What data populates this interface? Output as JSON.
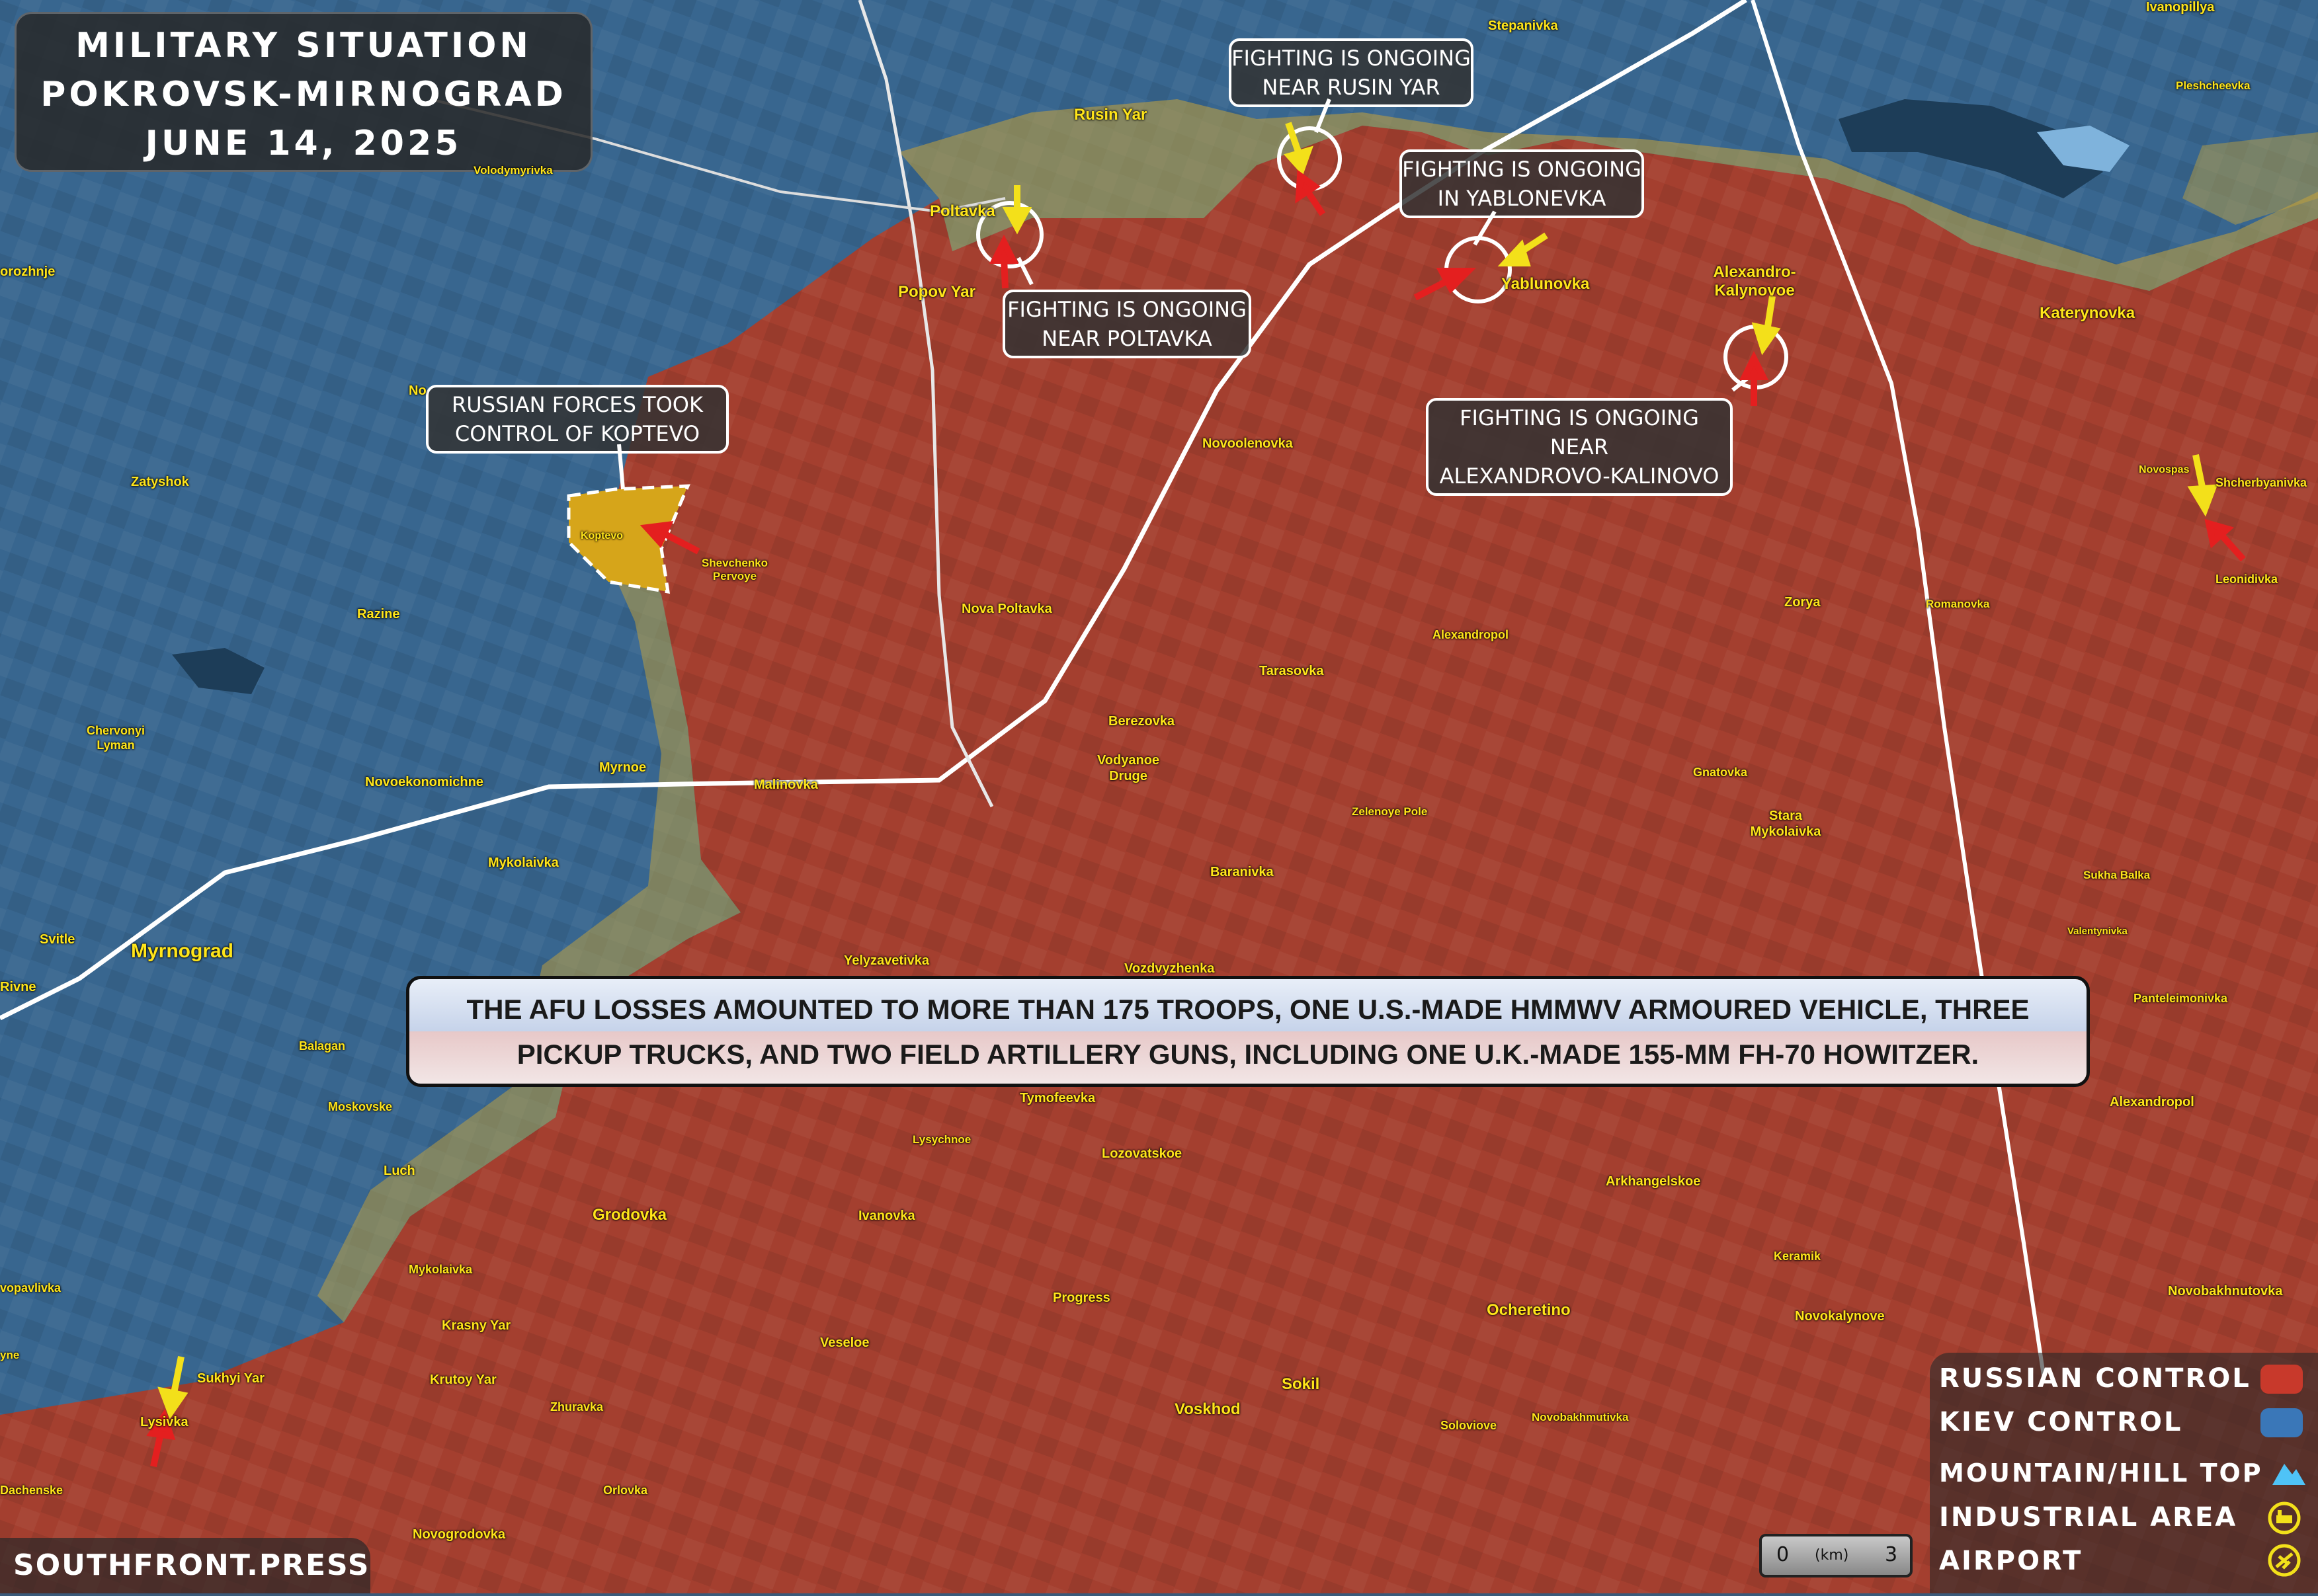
{
  "title": {
    "line1": "MILITARY SITUATION",
    "line2": "POKROVSK-MIRNOGRAD",
    "line3": "JUNE 14, 2025"
  },
  "colors": {
    "russian": "#b33a2c",
    "kiev": "#3a77b8",
    "contested": "#c7a33a",
    "label": "#ffe51a",
    "arrow_russian": "#e41f1f",
    "arrow_kiev": "#f3e01a"
  },
  "callouts": {
    "rusin_yar": [
      "FIGHTING IS ONGOING",
      "NEAR RUSIN YAR"
    ],
    "yablonevka": [
      "FIGHTING IS ONGOING",
      "IN YABLONEVKA"
    ],
    "poltavka": [
      "FIGHTING IS ONGOING",
      "NEAR POLTAVKA"
    ],
    "koptevo": [
      "RUSSIAN FORCES TOOK",
      "CONTROL OF KOPTEVO"
    ],
    "alexandrovo": [
      "FIGHTING IS ONGOING NEAR",
      "ALEXANDROVO-KALINOVO"
    ]
  },
  "places": {
    "stepanivka": "Stepanivka",
    "ivanopillya": "Ivanopillya",
    "pleshcheevka": "Pleshcheevka",
    "rusin_yar": "Rusin Yar",
    "volodymyrivka": "Volodymyrivka",
    "poltavka": "Poltavka",
    "popov_yar": "Popov Yar",
    "yablunovka": "Yablunovka",
    "alexandro_kalynovoe": "Alexandro-Kalynovoe",
    "katerynovka": "Katerynovka",
    "borozhnje": "orozhnje",
    "nikolaevka": "No",
    "zatyshok": "Zatyshok",
    "koptevo": "Koptevo",
    "shevchenko": "Shevchenko Pervoye",
    "novoolenovka": "Novoolenovka",
    "novospassk": "Novospas",
    "shcherbyanivka": "Shcherbyanivka",
    "leonidivka": "Leonidivka",
    "razine": "Razine",
    "nova_poltavka": "Nova Poltavka",
    "zorya": "Zorya",
    "romanovka": "Romanovka",
    "alexandropol": "Alexandropol",
    "tarasovka": "Tarasovka",
    "chervonyi_lyman": "Chervonyi Lyman",
    "berezovka": "Berezovka",
    "vodyanoe_druge": "Vodyanoe Druge",
    "novoekonomichne": "Novoekonomichne",
    "myrnoe": "Myrnoe",
    "malinovka": "Malinovka",
    "gnatovka": "Gnatovka",
    "zelenoye_pole": "Zelenoye Pole",
    "stara_mykolaivka": "Stara Mykolaivka",
    "mykolaivka_n": "Mykolaivka",
    "sukha_balka": "Sukha Balka",
    "baranivka": "Baranivka",
    "svitle": "Svitle",
    "myrnograd": "Myrnograd",
    "rivne": "Rivne",
    "valentynivka": "Valentynivka",
    "yelyzavetivka": "Yelyzavetivka",
    "vozdvyzhenka": "Vozdvyzhenka",
    "panteleimonivka": "Panteleimonivka",
    "balagan": "Balagan",
    "tymofeevka": "Tymofeevka",
    "alexandropol_s": "Alexandropol",
    "moskovske": "Moskovske",
    "lysychnoe": "Lysychnoe",
    "lozovatskoe": "Lozovatskoe",
    "luch": "Luch",
    "arkhangelskoe": "Arkhangelskoe",
    "grodovka": "Grodovka",
    "ivanovka": "Ivanovka",
    "keramik": "Keramik",
    "mykolaivka_s": "Mykolaivka",
    "novopavlivka": "vopavlivka",
    "progress": "Progress",
    "ocheretino": "Ocheretino",
    "novokalynove": "Novokalynove",
    "novobakhnutovka": "Novobakhnutovka",
    "krasny_yar": "Krasny Yar",
    "veseloe": "Veseloe",
    "sukhyi_yar": "Sukhyi Yar",
    "krutoy_yar": "Krutoy Yar",
    "lysivka": "Lysivka",
    "zhuravka": "Zhuravka",
    "voskhod": "Voskhod",
    "sokil": "Sokil",
    "soloviove": "Soloviove",
    "novobakhmutivka": "Novobakhmutivka",
    "dachenske": "Dachenske",
    "orlovka": "Orlovka",
    "novogrodovka": "Novogrodovka",
    "yne": "yne"
  },
  "summary": {
    "line1": "THE AFU LOSSES AMOUNTED TO MORE THAN 175 TROOPS, ONE U.S.-MADE HMMWV ARMOURED VEHICLE, THREE",
    "line2": "PICKUP TRUCKS, AND TWO FIELD ARTILLERY GUNS, INCLUDING ONE U.K.-MADE 155-MM FH-70 HOWITZER."
  },
  "legend": {
    "russian": "RUSSIAN CONTROL",
    "kiev": "KIEV CONTROL",
    "mountain": "MOUNTAIN/HILL TOP",
    "industrial": "INDUSTRIAL AREA",
    "airport": "AIRPORT",
    "icons": [
      "mountain-icon",
      "industrial-icon",
      "airport-icon"
    ]
  },
  "watermark": "SOUTHFRONT.PRESS",
  "scale": {
    "start": "0",
    "unit": "(km)",
    "end": "3"
  }
}
